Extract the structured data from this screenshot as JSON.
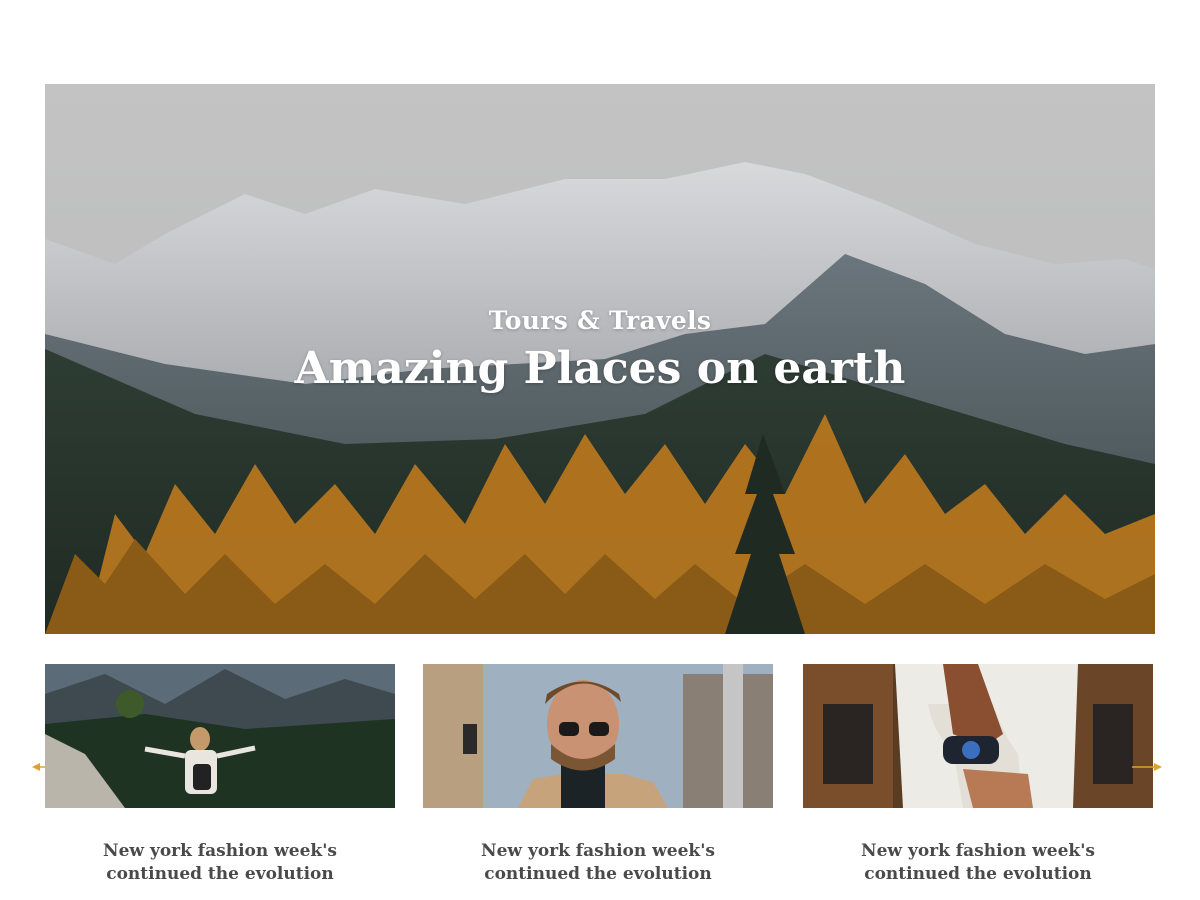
{
  "hero": {
    "subtitle": "Tours & Travels",
    "title": "Amazing Places on earth"
  },
  "carousel": {
    "prev_icon": "arrow-left-icon",
    "next_icon": "arrow-right-icon",
    "arrow_color": "#e0a030",
    "cards": [
      {
        "caption": "New york fashion week's continued the evolution",
        "image": "hiker-in-mountains"
      },
      {
        "caption": "New york fashion week's continued the evolution",
        "image": "man-with-glasses"
      },
      {
        "caption": "New york fashion week's continued the evolution",
        "image": "wrist-watch"
      }
    ]
  }
}
